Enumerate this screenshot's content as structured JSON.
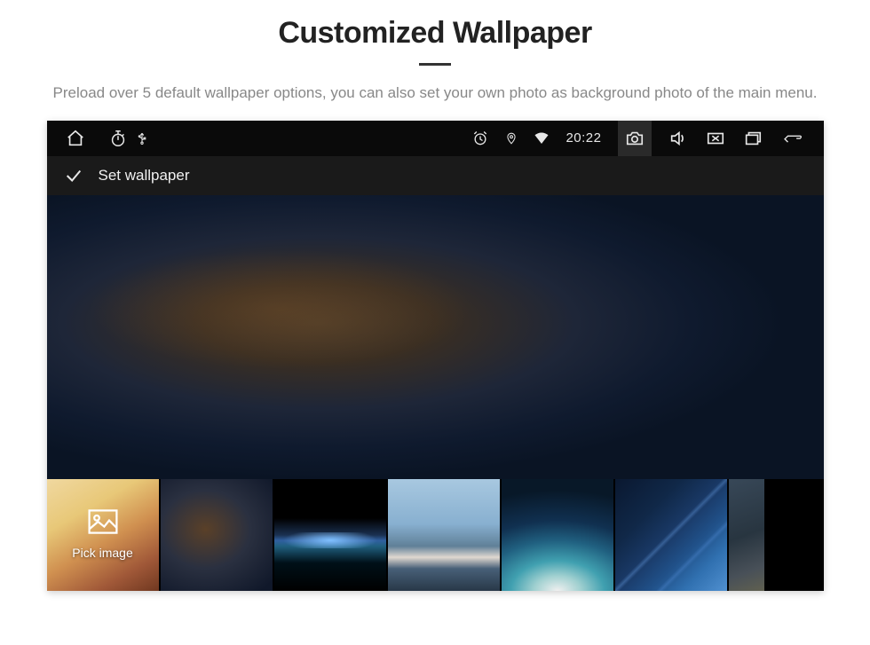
{
  "hero": {
    "title": "Customized Wallpaper",
    "subtitle": "Preload over 5 default wallpaper options, you can also set your own photo as background photo of the main menu."
  },
  "status_bar": {
    "clock": "20:22",
    "icons": {
      "home": "home-icon",
      "timer": "timer-icon",
      "usb": "usb-icon",
      "alarm": "alarm-icon",
      "location": "location-icon",
      "wifi": "wifi-icon",
      "camera": "camera-icon",
      "volume": "volume-icon",
      "close_screen": "screen-off-icon",
      "recent": "recent-apps-icon",
      "back": "back-icon"
    }
  },
  "header": {
    "confirm_icon": "check-icon",
    "title": "Set wallpaper"
  },
  "thumbnails": {
    "pick": {
      "icon": "image-icon",
      "label": "Pick image"
    },
    "items": [
      {
        "name": "wallpaper-warm-haze",
        "selected": true
      },
      {
        "name": "wallpaper-planet-horizon",
        "selected": false
      },
      {
        "name": "wallpaper-misty-clouds",
        "selected": false
      },
      {
        "name": "wallpaper-ocean-wave",
        "selected": false
      },
      {
        "name": "wallpaper-blue-diagonal",
        "selected": false
      },
      {
        "name": "wallpaper-grey-abstract",
        "selected": false
      }
    ]
  }
}
